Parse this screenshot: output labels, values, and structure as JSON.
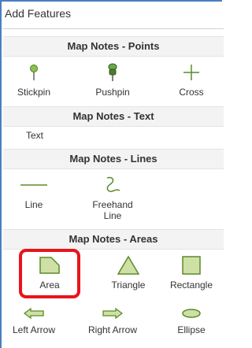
{
  "panel": {
    "title": "Add Features"
  },
  "sections": {
    "points": {
      "header": "Map Notes - Points",
      "items": [
        {
          "label": "Stickpin",
          "icon": "stickpin-icon"
        },
        {
          "label": "Pushpin",
          "icon": "pushpin-icon"
        },
        {
          "label": "Cross",
          "icon": "cross-icon"
        }
      ]
    },
    "text": {
      "header": "Map Notes - Text",
      "items": [
        {
          "label": "Text"
        }
      ]
    },
    "lines": {
      "header": "Map Notes - Lines",
      "items": [
        {
          "label": "Line",
          "icon": "line-icon"
        },
        {
          "label": "Freehand Line",
          "icon": "freehand-line-icon"
        }
      ]
    },
    "areas": {
      "header": "Map Notes - Areas",
      "items": [
        {
          "label": "Area",
          "icon": "area-icon"
        },
        {
          "label": "Triangle",
          "icon": "triangle-icon"
        },
        {
          "label": "Rectangle",
          "icon": "rectangle-icon"
        },
        {
          "label": "Left Arrow",
          "icon": "left-arrow-icon"
        },
        {
          "label": "Right Arrow",
          "icon": "right-arrow-icon"
        },
        {
          "label": "Ellipse",
          "icon": "ellipse-icon"
        }
      ]
    }
  },
  "colors": {
    "shape_fill": "#cfe0a6",
    "shape_stroke": "#5a8a2a",
    "header_bg": "#f3f3f3",
    "highlight": "#e8141c",
    "panel_border": "#4a7fc1"
  }
}
